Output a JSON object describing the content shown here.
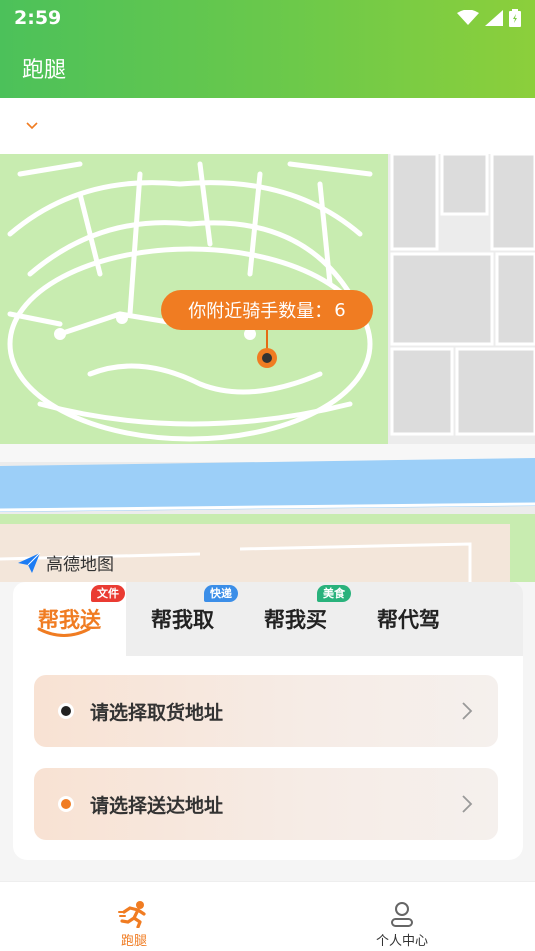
{
  "status": {
    "time": "2:59"
  },
  "header": {
    "title": "跑腿"
  },
  "map": {
    "bubble_label": "你附近骑手数量：",
    "rider_count": "6",
    "logo_text": "高德地图"
  },
  "tabs": [
    {
      "label": "帮我送",
      "badge": "文件",
      "badge_color": "#ea3b32",
      "active": true
    },
    {
      "label": "帮我取",
      "badge": "快递",
      "badge_color": "#3b8ee8",
      "active": false
    },
    {
      "label": "帮我买",
      "badge": "美食",
      "badge_color": "#29b27c",
      "active": false
    },
    {
      "label": "帮代驾",
      "badge": "",
      "active": false
    }
  ],
  "address": {
    "pickup_label": "请选择取货地址",
    "delivery_label": "请选择送达地址"
  },
  "nav": {
    "errand_label": "跑腿",
    "profile_label": "个人中心"
  },
  "colors": {
    "brand_orange": "#f07c22",
    "header_green": "#5cc652"
  }
}
